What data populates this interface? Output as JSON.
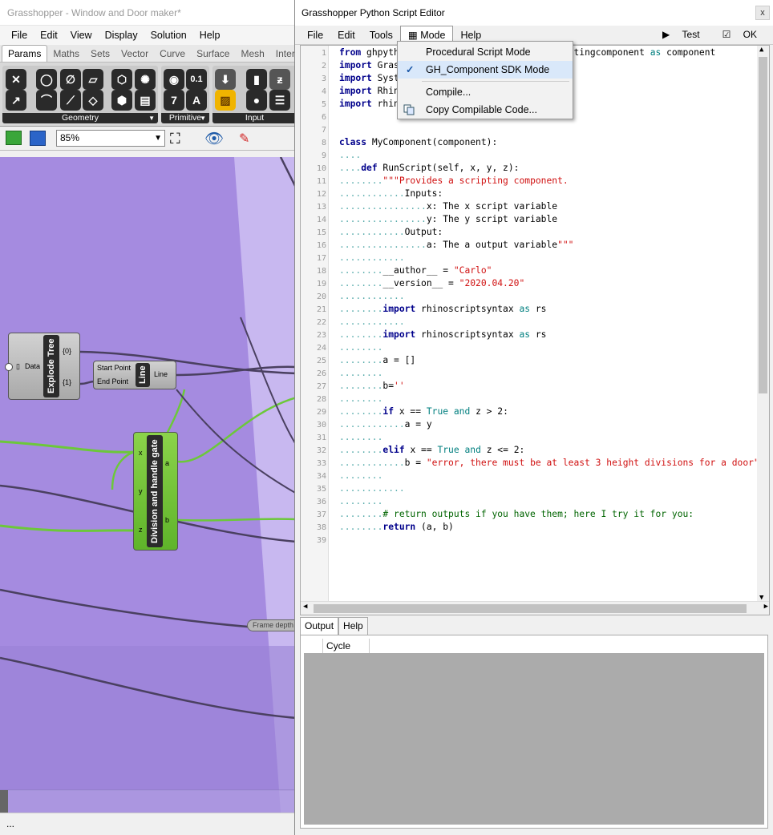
{
  "gh": {
    "title": "Grasshopper - Window and Door maker*",
    "menu": [
      "File",
      "Edit",
      "View",
      "Display",
      "Solution",
      "Help"
    ],
    "tabs": [
      "Params",
      "Maths",
      "Sets",
      "Vector",
      "Curve",
      "Surface",
      "Mesh",
      "Inter"
    ],
    "groups": [
      "Geometry",
      "Primitive",
      "Input"
    ],
    "zoom": "85%",
    "status": "...",
    "nodes": {
      "explode": {
        "title": "Explode Tree",
        "input": "Data",
        "outputs": [
          "{0}",
          "{1}"
        ]
      },
      "line": {
        "title": "Line",
        "inputs": [
          "Start Point",
          "End Point"
        ],
        "output": "Line"
      },
      "division": {
        "title": "Division and handle gate",
        "inputs": [
          "x",
          "y",
          "z"
        ],
        "outputs": [
          "a",
          "b"
        ]
      },
      "frame": {
        "label": "Frame depth"
      }
    }
  },
  "editor": {
    "title": "Grasshopper Python Script Editor",
    "close": "x",
    "menu": [
      "File",
      "Edit",
      "Tools",
      "Mode",
      "Help"
    ],
    "test": "Test",
    "ok": "OK",
    "dropdown": {
      "items": [
        "Procedural Script Mode",
        "GH_Component SDK Mode",
        "Compile...",
        "Copy Compilable Code..."
      ],
      "checked": "GH_Component SDK Mode"
    },
    "output_tabs": [
      "Output",
      "Help"
    ],
    "output_columns": [
      "",
      "Cycle"
    ],
    "code_lines": [
      "from ghpythonlib.componentbase import executingcomponent as component",
      "import Grasshopper, GhPython",
      "import System",
      "import Rhino",
      "import rhinoscriptsyntax as rs",
      "",
      "",
      "class MyComponent(component):",
      "....",
      "....def RunScript(self, x, y, z):",
      "........\"\"\"Provides a scripting component.",
      "............Inputs:",
      "................x: The x script variable",
      "................y: The y script variable",
      "............Output:",
      "................a: The a output variable\"\"\"",
      "............",
      "........__author__ = \"Carlo\"",
      "........__version__ = \"2020.04.20\"",
      "............",
      "........import rhinoscriptsyntax as rs",
      "............",
      "........import rhinoscriptsyntax as rs",
      "........",
      "........a = []",
      "........",
      "........b=''",
      "........",
      "........if x == True and z > 2:",
      "............a = y",
      "........",
      "........elif x == True and z <= 2:",
      "............b = \"error, there must be at least 3 height divisions for a door\"",
      "........",
      "............",
      "........",
      "........# return outputs if you have them; here I try it for you:",
      "........return (a, b)",
      ""
    ]
  }
}
